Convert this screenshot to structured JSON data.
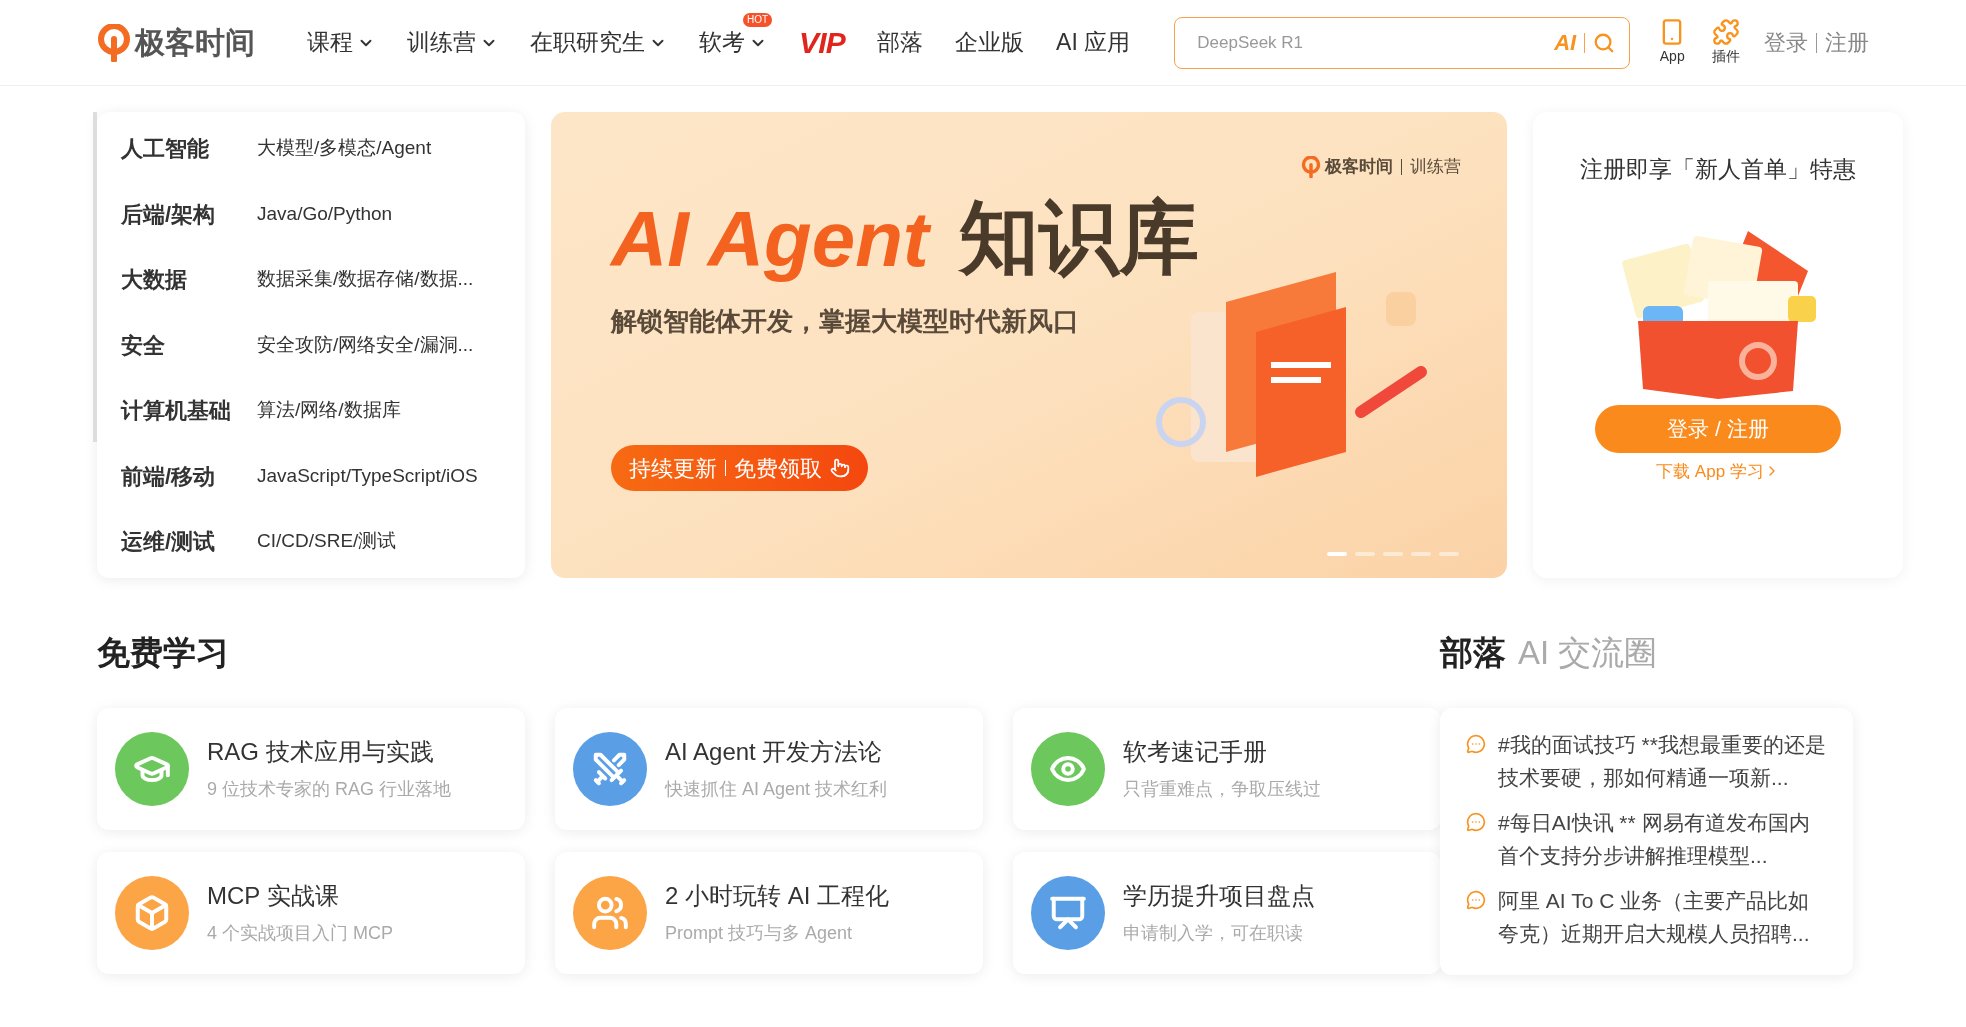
{
  "header": {
    "logo": "极客时间",
    "nav": [
      {
        "label": "课程",
        "kind": "dropdown"
      },
      {
        "label": "训练营",
        "kind": "dropdown"
      },
      {
        "label": "在职研究生",
        "kind": "dropdown"
      },
      {
        "label": "软考",
        "kind": "dropdown",
        "badge": "HOT"
      },
      {
        "label": "VIP",
        "kind": "vip"
      },
      {
        "label": "部落",
        "kind": "plain"
      },
      {
        "label": "企业版",
        "kind": "plain"
      },
      {
        "label": "AI 应用",
        "kind": "plain"
      }
    ],
    "search": {
      "placeholder": "DeepSeek R1",
      "ai_label": "AI"
    },
    "tools": [
      {
        "label": "App"
      },
      {
        "label": "插件"
      }
    ],
    "login": "登录",
    "register": "注册"
  },
  "categories": [
    {
      "name": "人工智能",
      "topics": "大模型/多模态/Agent"
    },
    {
      "name": "后端/架构",
      "topics": "Java/Go/Python"
    },
    {
      "name": "大数据",
      "topics": "数据采集/数据存储/数据..."
    },
    {
      "name": "安全",
      "topics": "安全攻防/网络安全/漏洞..."
    },
    {
      "name": "计算机基础",
      "topics": "算法/网络/数据库"
    },
    {
      "name": "前端/移动",
      "topics": "JavaScript/TypeScript/iOS"
    },
    {
      "name": "运维/测试",
      "topics": "CI/CD/SRE/测试"
    }
  ],
  "banner": {
    "brand": "极客时间",
    "brand_sub": "训练营",
    "title_en": "AI Agent",
    "title_cn": "知识库",
    "subtitle": "解锁智能体开发，掌握大模型时代新风口",
    "cta_left": "持续更新",
    "cta_right": "免费领取",
    "dots": [
      {
        "selected": true
      },
      {
        "selected": false
      },
      {
        "selected": false
      },
      {
        "selected": false
      },
      {
        "selected": false
      }
    ]
  },
  "promo": {
    "title": "注册即享「新人首单」特惠",
    "button": "登录 / 注册",
    "link": "下载 App 学习"
  },
  "free_learning": {
    "title": "免费学习",
    "cards": [
      {
        "title": "RAG 技术应用与实践",
        "subtitle": "9 位技术专家的 RAG 行业落地",
        "color": "#6cc85c"
      },
      {
        "title": "AI Agent 开发方法论",
        "subtitle": "快速抓住 AI Agent 技术红利",
        "color": "#5a9fe6"
      },
      {
        "title": "软考速记手册",
        "subtitle": "只背重难点，争取压线过",
        "color": "#6cc85c"
      },
      {
        "title": "MCP 实战课",
        "subtitle": "4 个实战项目入门 MCP",
        "color": "#fba546"
      },
      {
        "title": "2 小时玩转 AI 工程化",
        "subtitle": "Prompt 技巧与多 Agent",
        "color": "#fba546"
      },
      {
        "title": "学历提升项目盘点",
        "subtitle": "申请制入学，可在职读",
        "color": "#5a9fe6"
      }
    ]
  },
  "tribe": {
    "title": "部落",
    "subtitle": "AI 交流圈",
    "posts": [
      "#我的面试技巧 **我想最重要的还是技术要硬，那如何精通一项新...",
      "#每日AI快讯 ** 网易有道发布国内首个支持分步讲解推理模型...",
      "阿里 AI To C 业务（主要产品比如夸克）近期开启大规模人员招聘..."
    ]
  }
}
